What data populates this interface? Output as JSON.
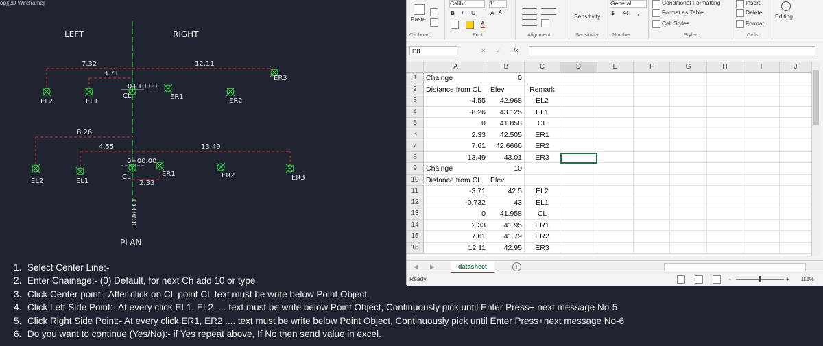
{
  "cad": {
    "viewport_label": "op][2D Wireframe]",
    "left_label": "LEFT",
    "right_label": "RIGHT",
    "plan_label": "PLAN",
    "road_label": "ROAD CL",
    "section1": {
      "dim_left_total": "7.32",
      "dim_left_inner": "3.71",
      "dim_right_total": "12.11",
      "cl_chainage": "0+10.00",
      "cl": "CL",
      "points": [
        "EL2",
        "EL1",
        "ER1",
        "ER2",
        "ER3"
      ]
    },
    "section2": {
      "dim_left_total": "8.26",
      "dim_left_inner": "4.55",
      "dim_right_total": "13.49",
      "dim_right_inner": "2.33",
      "cl_chainage": "0+00.00",
      "cl": "CL",
      "points": [
        "EL2",
        "EL1",
        "ER1",
        "ER2",
        "ER3"
      ]
    }
  },
  "instructions": [
    {
      "num": "1.",
      "text": "Select Center Line:-"
    },
    {
      "num": "2.",
      "text": "Enter Chainage:- (0) Default, for next Ch add 10 or type"
    },
    {
      "num": "3.",
      "text": "Click Center point:- After click on CL point CL text must be write below Point Object."
    },
    {
      "num": "4.",
      "text": "Click Left Side Point:- At every click EL1, EL2 .... text must be write below Point Object, Continuously pick until Enter Press+ next message No-5"
    },
    {
      "num": "5.",
      "text": "Click Right Side Point:- At every click ER1, ER2 .... text must be write below Point Object, Continuously pick until Enter Press+next message No-6"
    },
    {
      "num": "6.",
      "text": "Do you want to continue (Yes/No):- if Yes repeat above, If No then send value in excel."
    }
  ],
  "excel": {
    "ribbon": {
      "paste": "Paste",
      "font_name": "Calibri",
      "font_size": "11",
      "bold": "B",
      "italic": "I",
      "underline": "U",
      "grow_font": "A",
      "shrink_font": "A",
      "font_color": "A",
      "sensitivity": "Sensitivity",
      "number_format": "General",
      "currency": "$",
      "percent": "%",
      "comma": ",",
      "conditional_formatting": "Conditional Formatting",
      "format_as_table": "Format as Table",
      "cell_styles": "Cell Styles",
      "insert": "Insert",
      "delete": "Delete",
      "format": "Format",
      "editing": "Editing",
      "groups": [
        "Clipboard",
        "Font",
        "Alignment",
        "Sensitivity",
        "Number",
        "Styles",
        "Cells"
      ]
    },
    "name_box": "D8",
    "formula": "",
    "fx": "fx",
    "columns": [
      "A",
      "B",
      "C",
      "D",
      "E",
      "F",
      "G",
      "H",
      "I",
      "J"
    ],
    "rows": [
      {
        "n": "1",
        "a": "Chainge",
        "b": "0",
        "c": ""
      },
      {
        "n": "2",
        "a": "Distance from CL",
        "b": "Elev",
        "c": "Remark"
      },
      {
        "n": "3",
        "a": "-4.55",
        "b": "42.968",
        "c": "EL2"
      },
      {
        "n": "4",
        "a": "-8.26",
        "b": "43.125",
        "c": "EL1"
      },
      {
        "n": "5",
        "a": "0",
        "b": "41.858",
        "c": "CL"
      },
      {
        "n": "6",
        "a": "2.33",
        "b": "42.505",
        "c": "ER1"
      },
      {
        "n": "7",
        "a": "7.61",
        "b": "42.6666",
        "c": "ER2"
      },
      {
        "n": "8",
        "a": "13.49",
        "b": "43.01",
        "c": "ER3"
      },
      {
        "n": "9",
        "a": "Chainge",
        "b": "10",
        "c": ""
      },
      {
        "n": "10",
        "a": "Distance from CL",
        "b": "Elev",
        "c": ""
      },
      {
        "n": "11",
        "a": "-3.71",
        "b": "42.5",
        "c": "EL2"
      },
      {
        "n": "12",
        "a": "-0.732",
        "b": "43",
        "c": "EL1"
      },
      {
        "n": "13",
        "a": "0",
        "b": "41.958",
        "c": "CL"
      },
      {
        "n": "14",
        "a": "2.33",
        "b": "41.95",
        "c": "ER1"
      },
      {
        "n": "15",
        "a": "7.61",
        "b": "41.79",
        "c": "ER2"
      },
      {
        "n": "16",
        "a": "12.11",
        "b": "42.95",
        "c": "ER3"
      }
    ],
    "sheet_tab": "datasheet",
    "add_sheet": "+",
    "status": "Ready",
    "zoom": "115%",
    "zoom_minus": "-",
    "zoom_plus": "+"
  }
}
